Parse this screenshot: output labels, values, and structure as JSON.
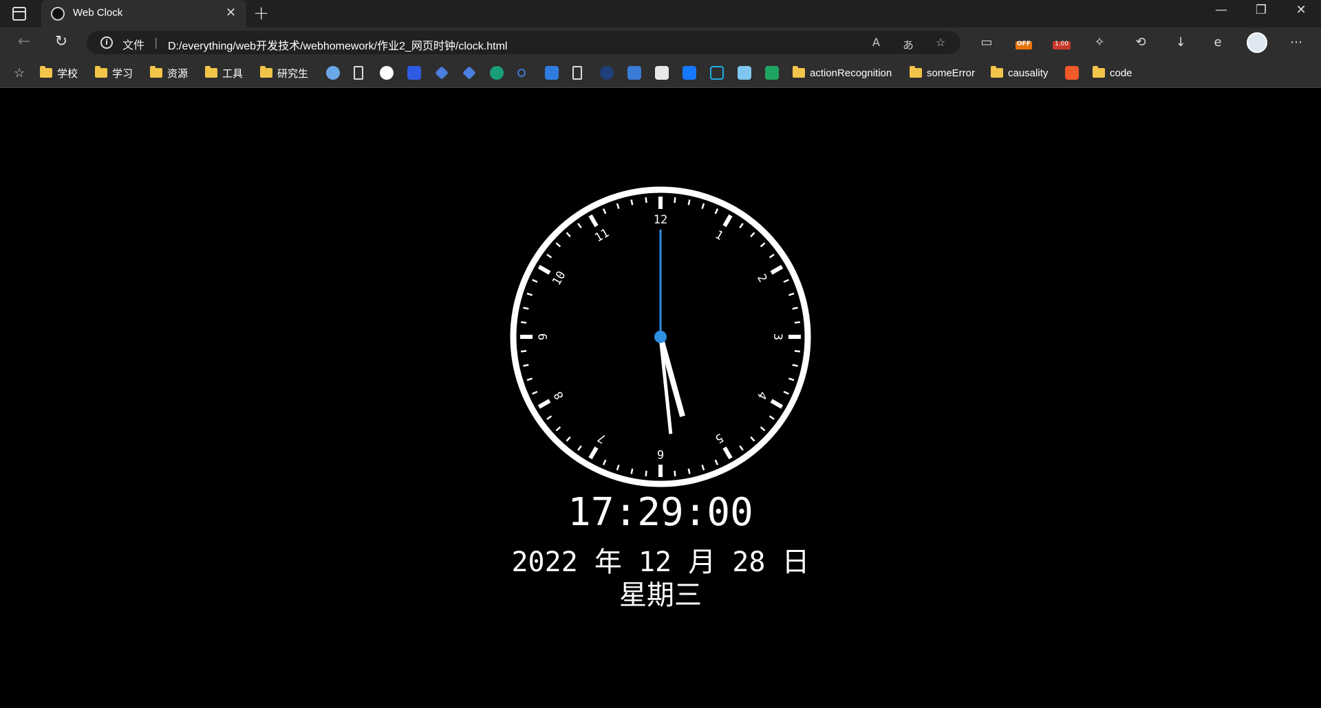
{
  "browser": {
    "tab_title": "Web Clock",
    "new_tab_symbol": "+",
    "close_symbol": "✕",
    "window_controls": [
      "—",
      "❐",
      "✕"
    ],
    "url_scheme_label": "文件",
    "url": "D:/everything/web开发技术/webhomework/作业2_网页时钟/clock.html",
    "extension_badges": [
      "OFF",
      "1.00"
    ]
  },
  "bookmarks": [
    {
      "type": "folder",
      "label": "学校"
    },
    {
      "type": "folder",
      "label": "学习"
    },
    {
      "type": "folder",
      "label": "资源"
    },
    {
      "type": "folder",
      "label": "工具"
    },
    {
      "type": "folder",
      "label": "研究生"
    },
    {
      "type": "folder",
      "label": "actionRecognition"
    },
    {
      "type": "folder",
      "label": "someError"
    },
    {
      "type": "folder",
      "label": "causality"
    },
    {
      "type": "folder",
      "label": "code"
    }
  ],
  "clock": {
    "time_text": "17:29:00",
    "date_text": "2022 年 12 月 28 日",
    "weekday_text": "星期三",
    "hour": 17,
    "minute": 29,
    "second": 0,
    "numerals": [
      "12",
      "1",
      "2",
      "3",
      "4",
      "5",
      "6",
      "7",
      "8",
      "9",
      "10",
      "11"
    ],
    "colors": {
      "face": "#000000",
      "ring": "#ffffff",
      "hands": "#ffffff",
      "second_hand": "#2f8fe0",
      "center": "#2f8fe0"
    }
  }
}
